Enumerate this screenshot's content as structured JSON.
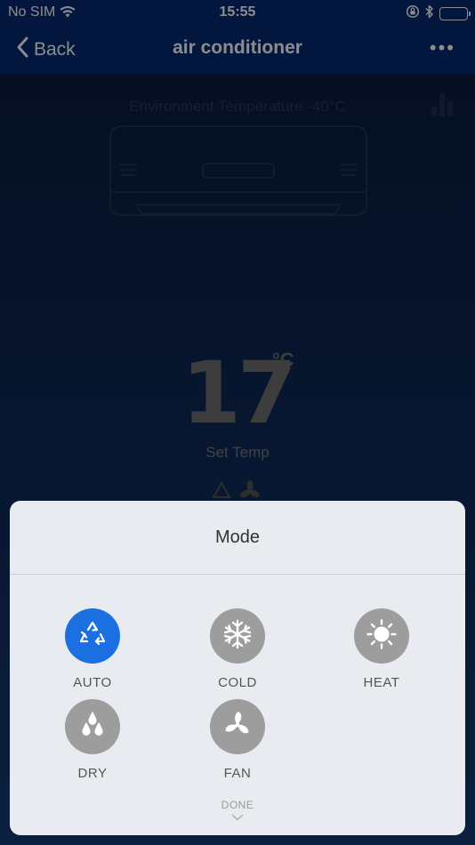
{
  "status_bar": {
    "carrier": "No SIM",
    "time": "15:55"
  },
  "nav": {
    "back_label": "Back",
    "title": "air conditioner",
    "more_label": "•••"
  },
  "main": {
    "environment_label": "Environment Temperature -40°C",
    "set_temp_value": "17",
    "set_temp_unit": "°C",
    "set_temp_label": "Set Temp"
  },
  "mode_sheet": {
    "title": "Mode",
    "modes": [
      {
        "label": "AUTO",
        "icon": "recycle-icon",
        "active": true
      },
      {
        "label": "COLD",
        "icon": "snowflake-icon",
        "active": false
      },
      {
        "label": "HEAT",
        "icon": "sun-icon",
        "active": false
      },
      {
        "label": "DRY",
        "icon": "water-drops-icon",
        "active": false
      },
      {
        "label": "FAN",
        "icon": "fan-icon",
        "active": false
      }
    ],
    "done_label": "DONE"
  },
  "colors": {
    "active_mode": "#1c6fe0",
    "inactive_mode": "#9d9d9d",
    "nav_bar": "#072a72"
  }
}
